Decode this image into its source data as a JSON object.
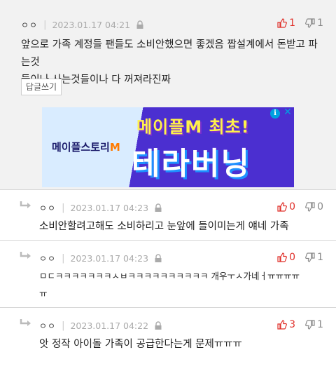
{
  "main_comment": {
    "nickname": "ㅇㅇ",
    "date": "2023.01.17 04:21",
    "upvotes": "1",
    "downvotes": "1",
    "text_line1": "앞으로 가족 계정들 팬들도 소비안했으면 좋겠음 짭설계에서 돈받고 파는것",
    "text_line2": "들이나 사는것들이나 다 꺼져라진짜",
    "reply_button": "답글쓰기"
  },
  "ad": {
    "logo_text": "메이플스토리",
    "logo_m": "M",
    "headline": "메이플M 최초!",
    "big_text": "테라버닝",
    "info_icon": "i",
    "close_icon": "✕"
  },
  "replies": [
    {
      "nickname": "ㅇㅇ",
      "date": "2023.01.17 04:23",
      "upvotes": "0",
      "downvotes": "0",
      "text_line1": "소비안할려고해도 소비하리고 눈앞에 들이미는게 얘네 가족",
      "text_line2": ""
    },
    {
      "nickname": "ㅇㅇ",
      "date": "2023.01.17 04:23",
      "upvotes": "0",
      "downvotes": "1",
      "text_line1": "ㅁㄷㅋㅋㅋㅋㅋㅋㅋㅅㅂㅋㅋㅋㅋㅋㅋㅋㅋㅋㅋ 개우ㅜㅅ가네ㅓㅠㅠㅠㅠ",
      "text_line2": "ㅠ"
    },
    {
      "nickname": "ㅇㅇ",
      "date": "2023.01.17 04:22",
      "upvotes": "3",
      "downvotes": "1",
      "text_line1": "앗 정작 아이돌 가족이 공급한다는게 문제ㅠㅠㅠ",
      "text_line2": ""
    }
  ],
  "colors": {
    "upvote": "#e0302a",
    "downvote": "#888888",
    "background": "#f2f2f2"
  }
}
